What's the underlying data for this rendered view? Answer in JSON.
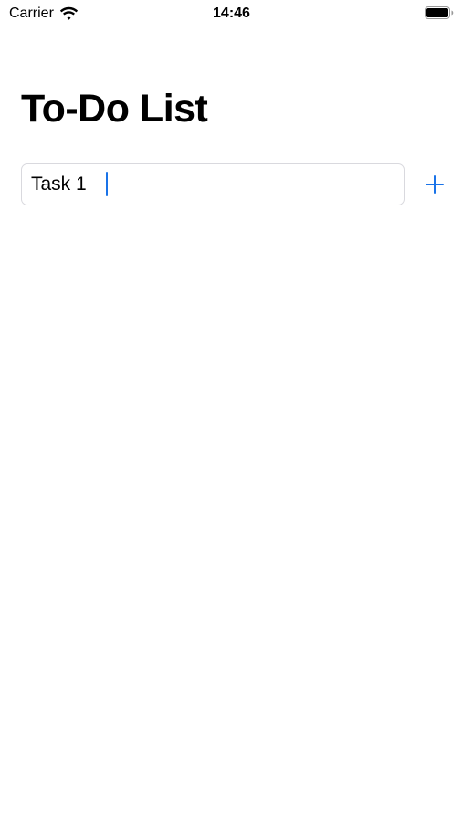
{
  "status_bar": {
    "carrier": "Carrier",
    "time": "14:46",
    "wifi_icon": "wifi-icon",
    "battery_icon": "battery-icon"
  },
  "page": {
    "title": "To-Do List"
  },
  "new_task": {
    "value": "Task 1",
    "add_icon": "plus-icon"
  },
  "colors": {
    "accent": "#1a73e8",
    "input_border": "#d9d9de",
    "background": "#ffffff",
    "text": "#000000"
  }
}
